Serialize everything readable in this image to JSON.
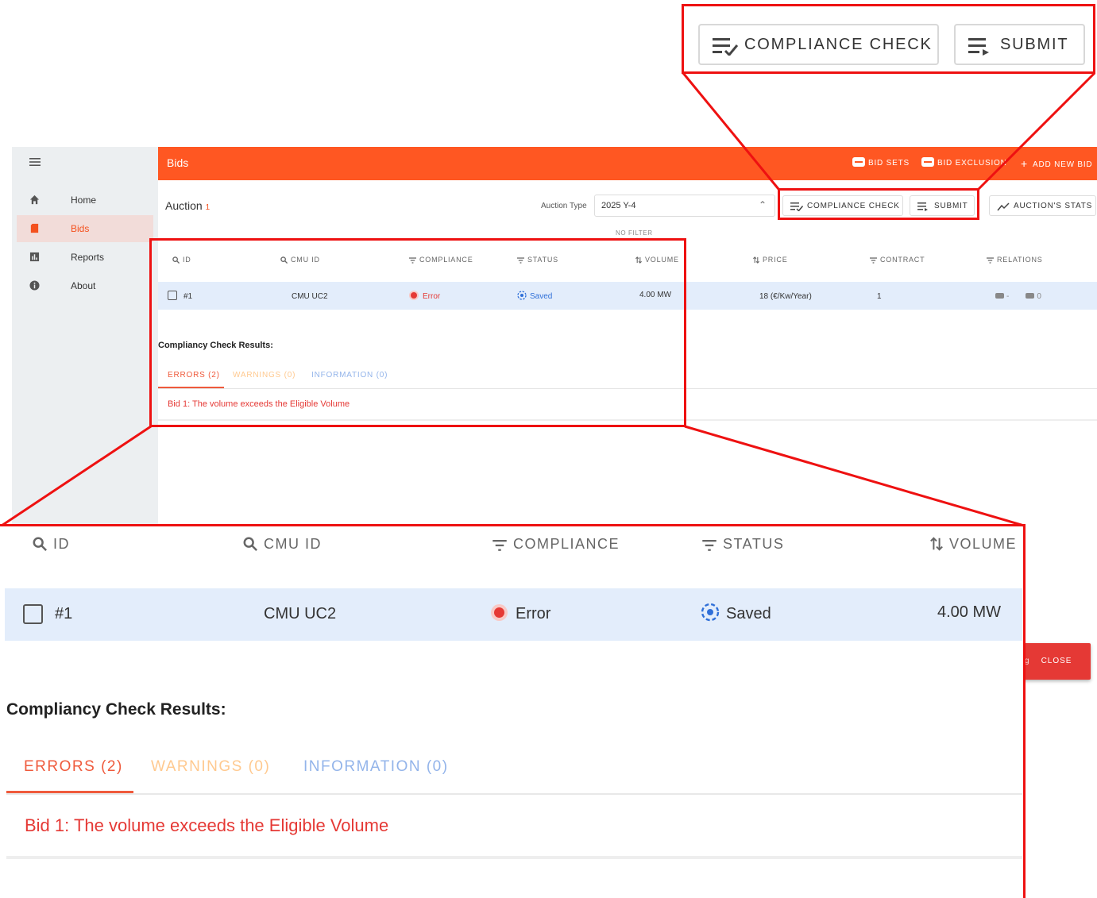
{
  "sidebar": {
    "items": [
      {
        "label": "Home",
        "icon": "home-icon"
      },
      {
        "label": "Bids",
        "icon": "bid-icon",
        "active": true
      },
      {
        "label": "Reports",
        "icon": "reports-icon"
      },
      {
        "label": "About",
        "icon": "info-icon"
      }
    ]
  },
  "appbar": {
    "title": "Bids",
    "bid_sets": "BID SETS",
    "bid_exclusion": "BID EXCLUSION",
    "add_new_bid": "ADD NEW BID"
  },
  "auction": {
    "title": "Auction",
    "required_mark": "1",
    "type_label": "Auction Type",
    "type_value": "2025 Y-4"
  },
  "toolbar": {
    "compliance_check": "COMPLIANCE CHECK",
    "submit": "SUBMIT",
    "auction_stats": "AUCTION'S STATS",
    "no_filter": "NO FILTER"
  },
  "table": {
    "columns": [
      "ID",
      "CMU ID",
      "COMPLIANCE",
      "STATUS",
      "VOLUME",
      "PRICE",
      "CONTRACT",
      "RELATIONS"
    ],
    "row": {
      "id": "#1",
      "cmu_id": "CMU UC2",
      "compliance": "Error",
      "status": "Saved",
      "volume": "4.00 MW",
      "price": "18 (€/Kw/Year)",
      "contract": "1",
      "relations_a": "-",
      "relations_b": "0"
    }
  },
  "results": {
    "title": "Compliancy Check Results:",
    "tabs": [
      "ERRORS (2)",
      "WARNINGS (0)",
      "INFORMATION (0)"
    ],
    "message": "Bid 1: The volume exceeds the Eligible Volume"
  },
  "snackbar": {
    "partial_text": "g",
    "close": "CLOSE"
  },
  "colors": {
    "brand": "#ff5722",
    "error": "#e53935",
    "saved": "#2f6fd8",
    "row_highlight": "#e3edfb",
    "callout": "#ee1111"
  }
}
